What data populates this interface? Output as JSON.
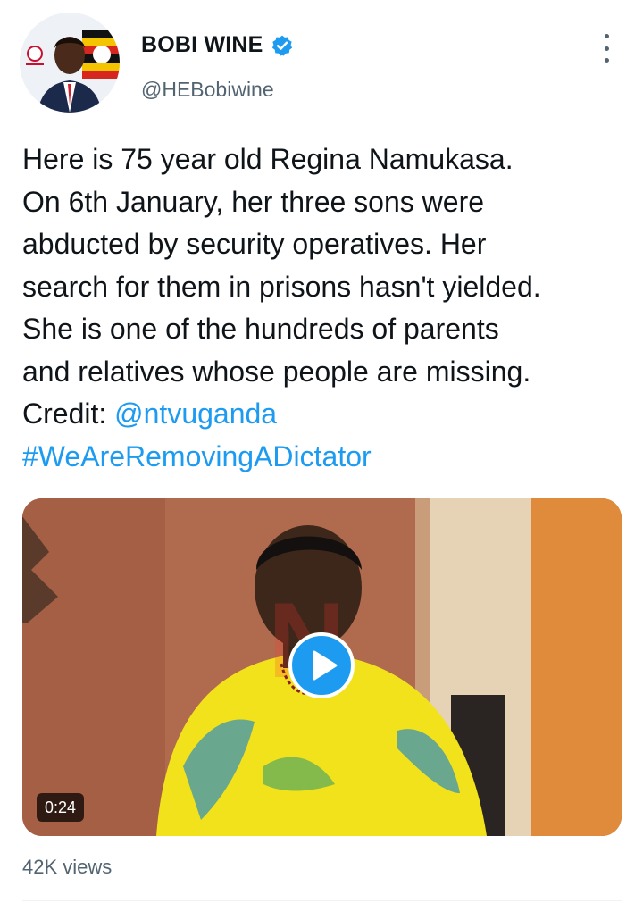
{
  "tweet": {
    "author": {
      "display_name": "BOBI WINE",
      "handle": "@HEBobiwine",
      "verified": true,
      "avatar_icon": "profile-photo",
      "verified_icon": "verified-badge-icon"
    },
    "more_icon": "more-options-icon",
    "text": {
      "body": "Here is 75 year old Regina Namukasa.\nOn 6th January, her three sons were\nabducted by security operatives. Her\nsearch for them in prisons hasn't yielded.\nShe is one of the hundreds of parents\nand relatives whose people are missing.\nCredit: ",
      "mention": "@ntvuganda",
      "hashtag": "#WeAreRemovingADictator"
    },
    "media": {
      "type": "video",
      "duration": "0:24",
      "play_icon": "play-icon"
    },
    "views": "42K views"
  },
  "colors": {
    "link": "#1d9bf0",
    "secondary_text": "#536471",
    "primary_text": "#0f1419",
    "play_button": "#1d9bf0"
  }
}
